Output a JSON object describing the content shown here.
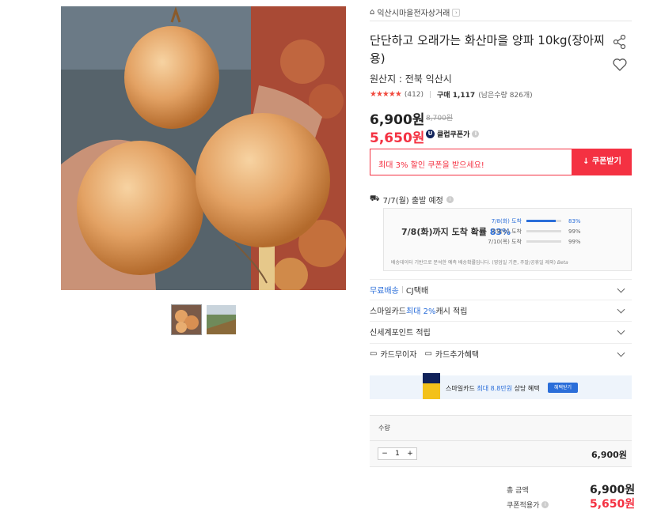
{
  "store": {
    "name": "익산시마을전자상거래",
    "chevron": "›"
  },
  "product": {
    "title": "단단하고 오래가는 화산마을 양파 10kg(장아찌용)",
    "origin": "원산지 : 전북 익산시",
    "rating_stars": "★★★★★",
    "review_count": "(412)",
    "purchase": "구매 1,117",
    "stock": "(남은수량 826개)"
  },
  "price": {
    "current": "6,900원",
    "original": "8,700원",
    "club": "5,650원",
    "club_badge_letter": "U",
    "club_label": "클럽쿠폰가"
  },
  "coupon": {
    "text": "최대 3% 할인 쿠폰을 받으세요!",
    "button": "↓ 쿠폰받기"
  },
  "shipping": {
    "departure": "7/7(월) 출발 예정",
    "estimate_prefix": "7/8(화)까지 도착 확률 ",
    "estimate_pct": "83%",
    "bars": [
      {
        "label": "7/8(화) 도착",
        "pct_text": "83%",
        "fraction": 0.83,
        "highlight": true
      },
      {
        "label": "7/9(수) 도착",
        "pct_text": "99%",
        "fraction": 0.0,
        "highlight": false
      },
      {
        "label": "7/10(목) 도착",
        "pct_text": "99%",
        "fraction": 0.0,
        "highlight": false
      }
    ],
    "note": "배송데이터 기반으로 분석한 예측 배송확률입니다. (영업일 기준, 주말/공휴일 제외)",
    "beta": "Beta"
  },
  "rows": {
    "free_shipping": "무료배송",
    "courier": "CJ택배",
    "smilecard_prefix": "스마일카드 ",
    "smilecard_highlight": "최대 2%",
    "smilecard_suffix": " 캐시 적립",
    "shinsegae": "신세계포인트 적립",
    "card_interest": "카드무이자",
    "card_benefit": "카드추가혜택"
  },
  "banner": {
    "prefix": "스마일카드 ",
    "highlight": "최대 8.8만원",
    "suffix": " 상당 혜택",
    "button": "혜택받기"
  },
  "quantity": {
    "label": "수량",
    "minus": "−",
    "value": "1",
    "plus": "+",
    "price": "6,900원"
  },
  "totals": {
    "total_label": "총 금액",
    "total_value": "6,900원",
    "coupon_label": "쿠폰적용가",
    "coupon_value": "5,650원"
  },
  "colors": {
    "accent_red": "#f43142",
    "accent_blue": "#2b6ed9",
    "star": "#f04a3e"
  },
  "icons": [
    "store-icon",
    "share-icon",
    "heart-icon",
    "truck-icon",
    "info-icon",
    "card-icon",
    "chevron-down-icon"
  ]
}
